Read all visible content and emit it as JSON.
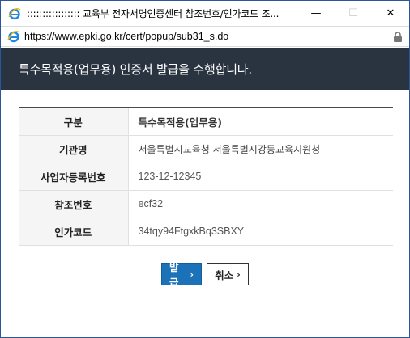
{
  "window": {
    "title": "::::::::::::::::: 교육부 전자서명인증센터 참조번호/인가코드 조...",
    "minimize": "—",
    "maximize": "☐",
    "close": "✕"
  },
  "address": {
    "url": "https://www.epki.go.kr/cert/popup/sub31_s.do"
  },
  "header": {
    "title": "특수목적용(업무용) 인증서 발급을 수행합니다."
  },
  "table": {
    "rows": [
      {
        "label": "구분",
        "value": "특수목적용(업무용)"
      },
      {
        "label": "기관명",
        "value": "서울특별시교육청 서울특별시강동교육지원청"
      },
      {
        "label": "사업자등록번호",
        "value": "123-12-12345"
      },
      {
        "label": "참조번호",
        "value": "ecf32"
      },
      {
        "label": "인가코드",
        "value": "34tqy94FtgxkBq3SBXY"
      }
    ]
  },
  "buttons": {
    "issue_label": "발급",
    "cancel_label": "취소",
    "chevron": "›"
  },
  "colors": {
    "header_bg": "#2a3441",
    "primary_button": "#1c72b8",
    "window_border": "#2b579a"
  }
}
